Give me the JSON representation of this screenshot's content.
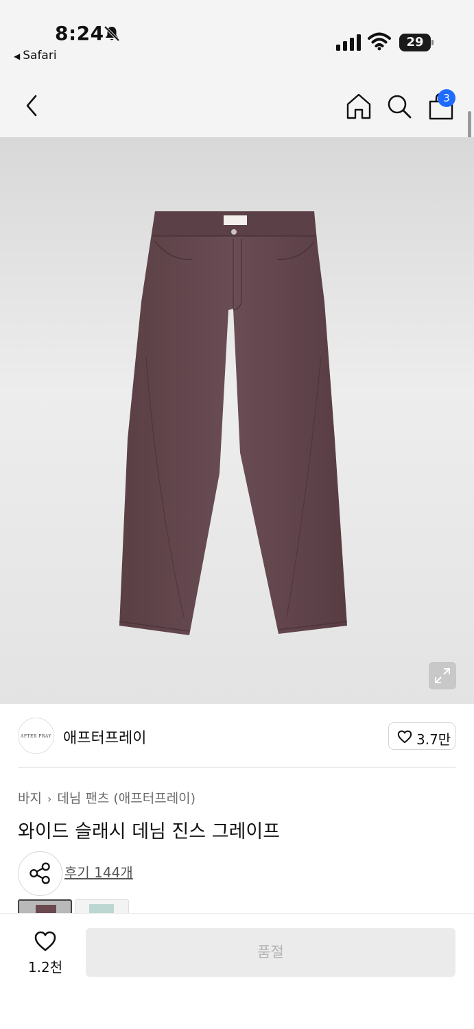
{
  "status_bar": {
    "time": "8:24",
    "back_app": "Safari",
    "battery": "29",
    "icons": [
      "bell-slash-icon",
      "cellular-signal-icon",
      "wifi-icon",
      "battery-icon"
    ]
  },
  "header": {
    "cart_count": "3",
    "icons": [
      "back-arrow-icon",
      "home-icon",
      "search-icon",
      "cart-icon"
    ]
  },
  "product": {
    "image_colors": {
      "denim": "#5f4349",
      "background": "#e6e6e6"
    },
    "brand_logo_text": "AFTER PRAY",
    "brand_name": "애프터프레이",
    "brand_likes": "3.7만",
    "breadcrumb": {
      "category": "바지",
      "subcategory": "데님 팬츠 (애프터프레이)"
    },
    "title": "와이드 슬래시 데님 진스 그레이프",
    "reviews": "후기 144개"
  },
  "bottom_bar": {
    "wish_count": "1.2천",
    "buy_button": "품절"
  },
  "colors": {
    "accent": "#1f6bff",
    "header_bg": "#f4f4f4",
    "disabled_bg": "#ebebeb",
    "disabled_text": "#b3b3b3"
  }
}
